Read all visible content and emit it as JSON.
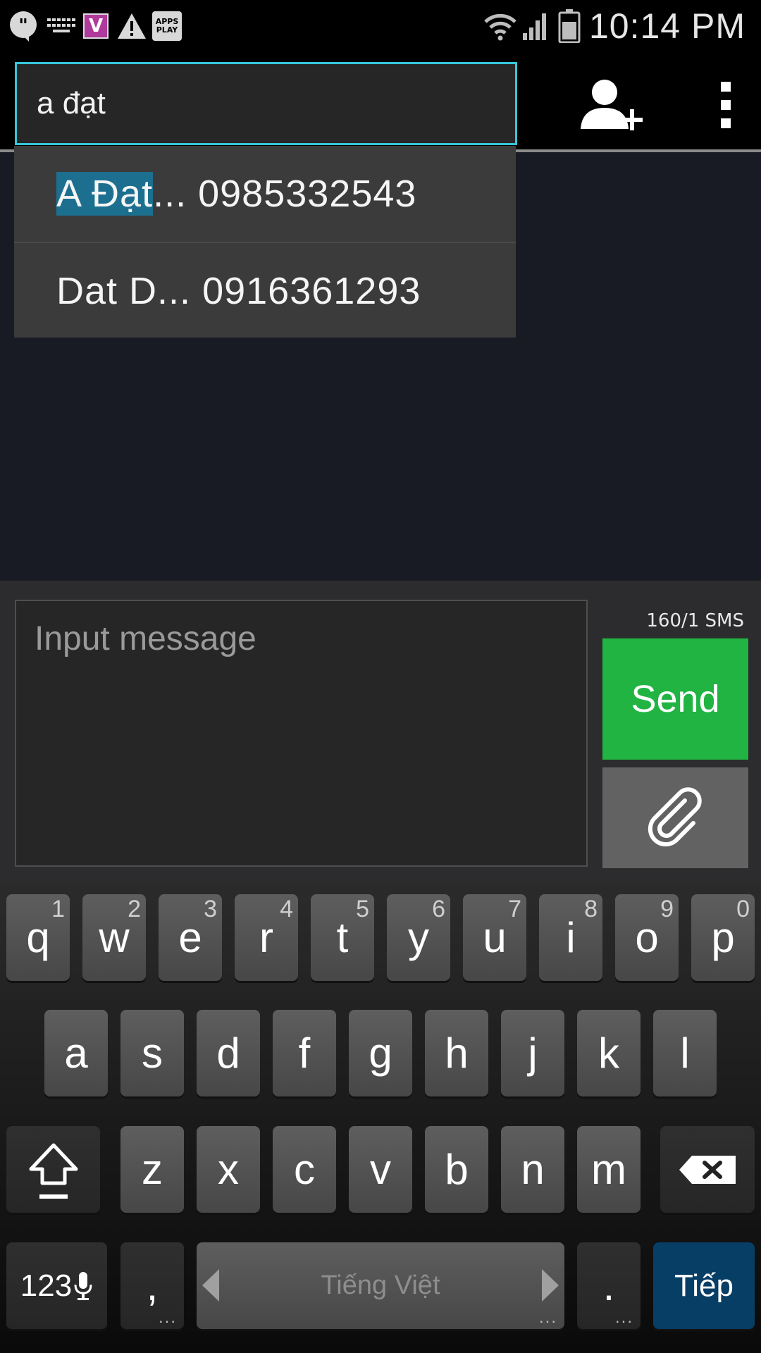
{
  "status_bar": {
    "time": "10:14 PM",
    "notif_icons": [
      "hangouts-icon",
      "keyboard-icon",
      "viber-icon",
      "warning-icon",
      "apps-play-icon"
    ],
    "apps_play_label": "APPS PLAY",
    "viber_letter": "V",
    "right_icons": [
      "wifi-icon",
      "signal-icon",
      "battery-icon"
    ]
  },
  "header": {
    "recipient_value": "a  đạt",
    "add_contact_icon": "add-contact-icon",
    "overflow_icon": "overflow-menu-icon",
    "accent": "#36c6d9"
  },
  "suggestions": [
    {
      "match": "A Đạt",
      "rest": "...",
      "number": "0985332543"
    },
    {
      "match": "",
      "rest": "Dat D...",
      "number": "0916361293"
    }
  ],
  "compose": {
    "placeholder": "Input message",
    "counter": "160/1  SMS",
    "send_label": "Send",
    "send_color": "#21b442",
    "attach_icon": "paperclip-icon"
  },
  "keyboard": {
    "row1": [
      {
        "k": "q",
        "n": "1"
      },
      {
        "k": "w",
        "n": "2"
      },
      {
        "k": "e",
        "n": "3"
      },
      {
        "k": "r",
        "n": "4"
      },
      {
        "k": "t",
        "n": "5"
      },
      {
        "k": "y",
        "n": "6"
      },
      {
        "k": "u",
        "n": "7"
      },
      {
        "k": "i",
        "n": "8"
      },
      {
        "k": "o",
        "n": "9"
      },
      {
        "k": "p",
        "n": "0"
      }
    ],
    "row2": [
      "a",
      "s",
      "d",
      "f",
      "g",
      "h",
      "j",
      "k",
      "l"
    ],
    "row3": [
      "z",
      "x",
      "c",
      "v",
      "b",
      "n",
      "m"
    ],
    "sym_label": "123",
    "comma": ",",
    "space_label": "Tiếng Việt",
    "period": ".",
    "next_label": "Tiếp",
    "next_color": "#073e66"
  }
}
